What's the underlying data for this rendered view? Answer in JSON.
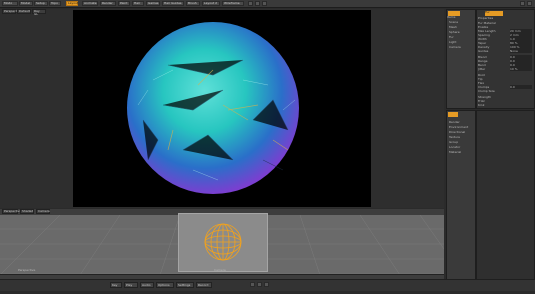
{
  "toolbar": {
    "items": [
      "Modo",
      "Model",
      "Setup",
      "Topo",
      "Layout",
      "Animate",
      "Render",
      "Paint",
      "Hair",
      "Games",
      "Hair Guides",
      "Brush",
      "Layout 2",
      "Wireframe"
    ],
    "active_index": 4
  },
  "viewport": {
    "tabs": [
      "Perspective",
      "Default",
      "Ray GL"
    ],
    "info": "Render"
  },
  "properties": {
    "title": "Properties",
    "tab_label": "Fur",
    "rows": [
      "Fur Material",
      "Enable",
      "Max Length",
      "Spacing",
      "Width",
      "Taper",
      "Density",
      "Guides",
      "Blend",
      "Range",
      "Bend",
      "Jitter",
      "Root",
      "Tip",
      "Flex",
      "Clumps",
      "Clump Size",
      "Strength",
      "Frizz",
      "Kink",
      "Use Fur"
    ],
    "values": [
      "",
      "",
      "20 mm",
      "2 mm",
      "1.0",
      "80 %",
      "100 %",
      "None",
      "0.0",
      "0.0",
      "0.0",
      "10 %",
      "",
      "",
      "",
      "0.0",
      "",
      "",
      "",
      "",
      ""
    ]
  },
  "items_panel": {
    "title": "Items",
    "entries": [
      "Scene",
      "Mesh",
      "Sphere",
      "Fur",
      "Light",
      "Camera",
      "Render",
      "Environment",
      "Directional",
      "Texture",
      "Group",
      "Locator",
      "Material"
    ]
  },
  "bottom_viewport": {
    "tabs": [
      "Perspective",
      "Shaded",
      "Camera"
    ],
    "camera_label": "Camera",
    "grid_label": "Grid",
    "info": "Perspective"
  },
  "statusbar": {
    "buttons": [
      "Key",
      "Play",
      "Audio",
      "Options",
      "Settings",
      "Record"
    ]
  },
  "colors": {
    "accent": "#e59b25",
    "fur_teal": "#27c6c0",
    "fur_purple": "#7a3fd0",
    "fur_gold": "#d7b24a"
  }
}
